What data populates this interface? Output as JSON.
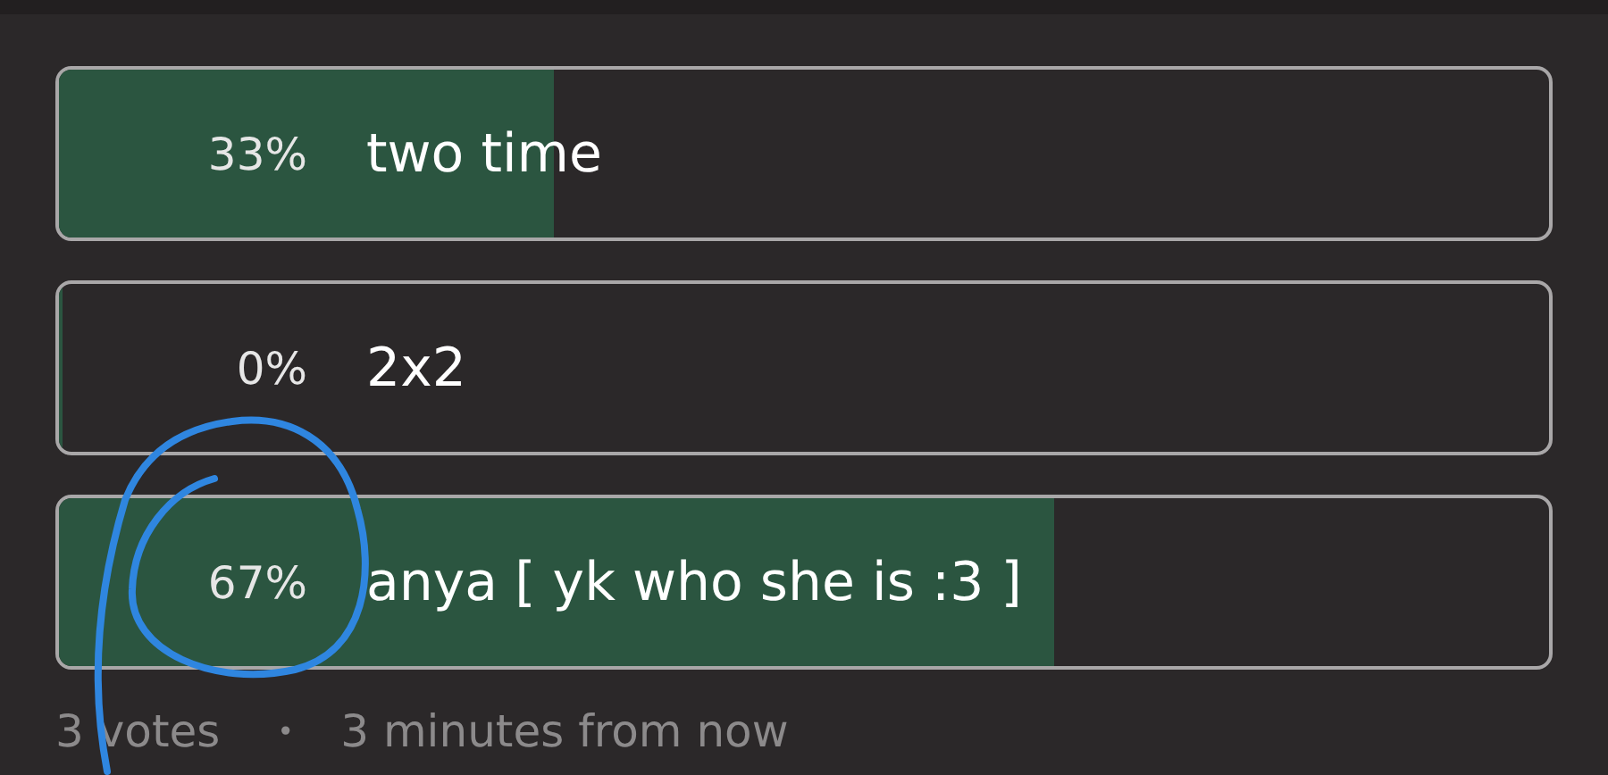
{
  "options": [
    {
      "percent": "33%",
      "label": "two time",
      "level": 0.33
    },
    {
      "percent": "0%",
      "label": "2x2",
      "level": 0.0
    },
    {
      "percent": "67%",
      "label": "anya [ yk who she is :3 ]",
      "level": 0.665
    }
  ],
  "footer": {
    "votes": "3 votes",
    "separator": "•",
    "time": "3 minutes from now"
  }
}
